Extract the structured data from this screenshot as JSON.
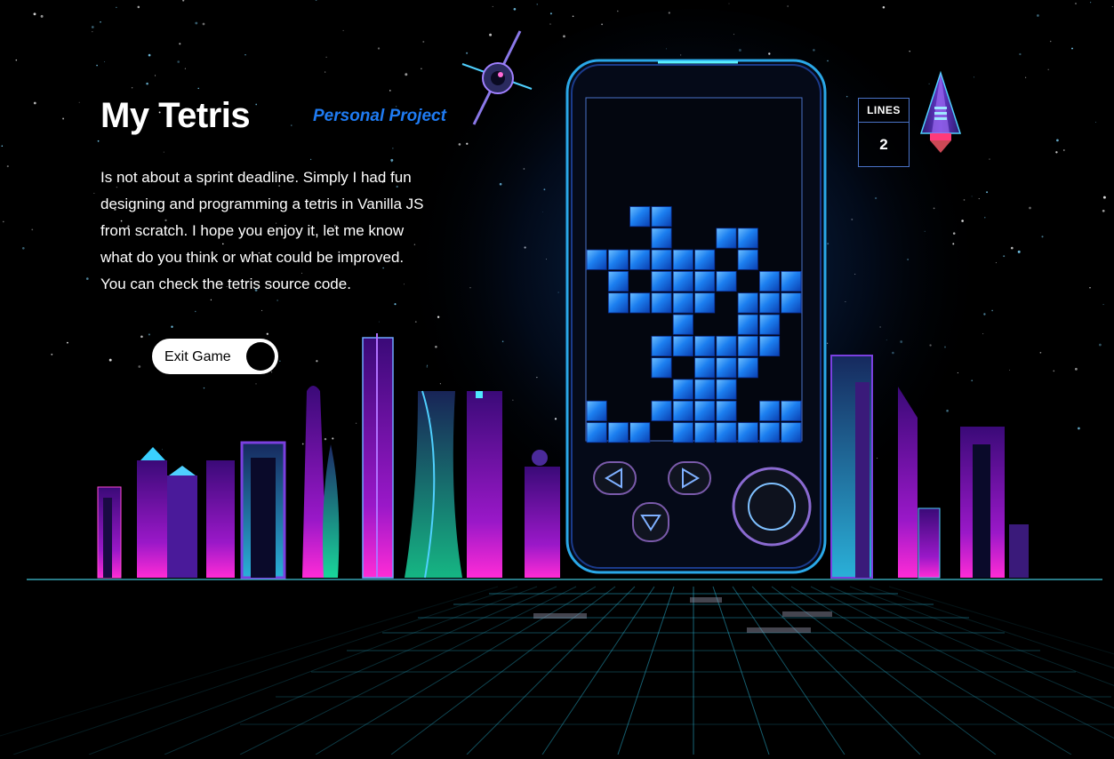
{
  "header": {
    "title": "My Tetris",
    "tag": "Personal Project"
  },
  "description": {
    "lines": [
      "Is not about a sprint deadline. Simply I had fun",
      "designing and programming a tetris in Vanilla JS",
      "from scratch. I hope you enjoy it, let me know",
      "what do you think or what could be improved.",
      "You can check the tetris source code."
    ]
  },
  "exit_button": {
    "label": "Exit Game"
  },
  "score": {
    "label": "LINES",
    "value": "2"
  },
  "board": {
    "columns": 10,
    "rows": 16,
    "rows_from_top": [
      "..........",
      "..........",
      "..........",
      "..........",
      "..........",
      "..##......",
      "...#..##..",
      "######.#..",
      ".#.####.##",
      ".#####.###",
      "....#..##.",
      "...######.",
      "...#.###..",
      "....###...",
      "#..####.##",
      "###.######"
    ]
  },
  "controls": {
    "left": "left-arrow-icon",
    "right": "right-arrow-icon",
    "down": "down-arrow-icon",
    "rotate": "circle-icon"
  },
  "colors": {
    "accent_blue": "#1f7bf2",
    "block": "#1c7ff0",
    "neon_cyan": "#28e6ff",
    "neon_magenta": "#ff2bd6"
  }
}
